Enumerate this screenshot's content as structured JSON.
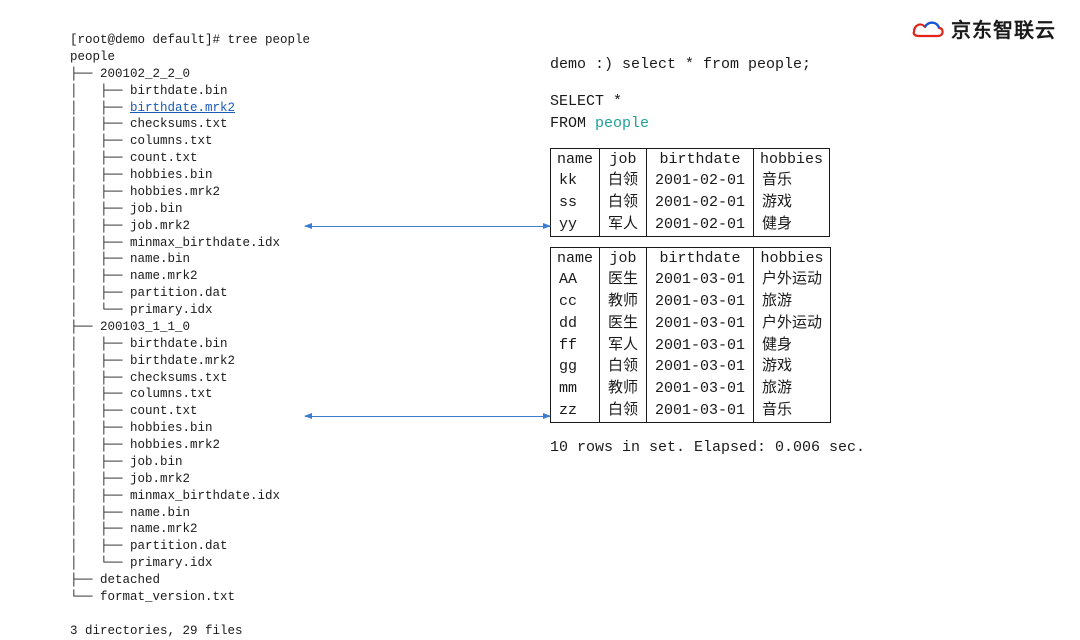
{
  "brand": {
    "name": "京东智联云"
  },
  "tree": {
    "prompt": "[root@demo default]# tree people",
    "root": "people",
    "partitions": [
      {
        "dir": "200102_2_2_0",
        "files": [
          "birthdate.bin",
          "birthdate.mrk2",
          "checksums.txt",
          "columns.txt",
          "count.txt",
          "hobbies.bin",
          "hobbies.mrk2",
          "job.bin",
          "job.mrk2",
          "minmax_birthdate.idx",
          "name.bin",
          "name.mrk2",
          "partition.dat",
          "primary.idx"
        ],
        "highlight_index": 1
      },
      {
        "dir": "200103_1_1_0",
        "files": [
          "birthdate.bin",
          "birthdate.mrk2",
          "checksums.txt",
          "columns.txt",
          "count.txt",
          "hobbies.bin",
          "hobbies.mrk2",
          "job.bin",
          "job.mrk2",
          "minmax_birthdate.idx",
          "name.bin",
          "name.mrk2",
          "partition.dat",
          "primary.idx"
        ]
      }
    ],
    "extra_dirs": [
      "detached",
      "format_version.txt"
    ],
    "summary": "3 directories, 29 files"
  },
  "query": {
    "cli_line": "demo :) select * from people;",
    "select_kw": "SELECT",
    "select_cols": "*",
    "from_kw": "FROM",
    "from_table": "people",
    "rows_summary": "10 rows in set. Elapsed: 0.006 sec."
  },
  "tables": {
    "headers": [
      "name",
      "job",
      "birthdate",
      "hobbies"
    ],
    "groups": [
      {
        "rows": [
          [
            "kk",
            "白领",
            "2001-02-01",
            "音乐"
          ],
          [
            "ss",
            "白领",
            "2001-02-01",
            "游戏"
          ],
          [
            "yy",
            "军人",
            "2001-02-01",
            "健身"
          ]
        ]
      },
      {
        "rows": [
          [
            "AA",
            "医生",
            "2001-03-01",
            "户外运动"
          ],
          [
            "cc",
            "教师",
            "2001-03-01",
            "旅游"
          ],
          [
            "dd",
            "医生",
            "2001-03-01",
            "户外运动"
          ],
          [
            "ff",
            "军人",
            "2001-03-01",
            "健身"
          ],
          [
            "gg",
            "白领",
            "2001-03-01",
            "游戏"
          ],
          [
            "mm",
            "教师",
            "2001-03-01",
            "旅游"
          ],
          [
            "zz",
            "白领",
            "2001-03-01",
            "音乐"
          ]
        ]
      }
    ]
  }
}
